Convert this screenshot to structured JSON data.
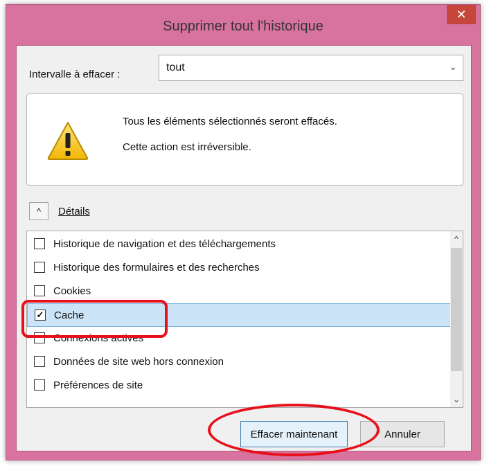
{
  "window": {
    "title": "Supprimer tout l'historique",
    "close_glyph": "✕",
    "frame_color": "#d8739f"
  },
  "range": {
    "label": "Intervalle à effacer :",
    "value": "tout",
    "arrow_glyph": "⌄"
  },
  "warning": {
    "icon": "warning-icon",
    "line1": "Tous les éléments sélectionnés seront effacés.",
    "line2": "Cette action est irréversible."
  },
  "details": {
    "toggle_glyph": "^",
    "label": "Détails"
  },
  "history_items": [
    {
      "label": "Historique de navigation et des téléchargements",
      "checked": false,
      "selected": false
    },
    {
      "label": "Historique des formulaires et des recherches",
      "checked": false,
      "selected": false
    },
    {
      "label": "Cookies",
      "checked": false,
      "selected": false
    },
    {
      "label": "Cache",
      "checked": true,
      "selected": true
    },
    {
      "label": "Connexions actives",
      "checked": false,
      "selected": false
    },
    {
      "label": "Données de site web hors connexion",
      "checked": false,
      "selected": false
    },
    {
      "label": "Préférences de site",
      "checked": false,
      "selected": false
    }
  ],
  "check_glyph": "✓",
  "scrollbar": {
    "up_glyph": "^",
    "down_glyph": "⌄"
  },
  "buttons": {
    "clear_now": "Effacer maintenant",
    "cancel": "Annuler"
  },
  "annotation_color": "#e8101a"
}
